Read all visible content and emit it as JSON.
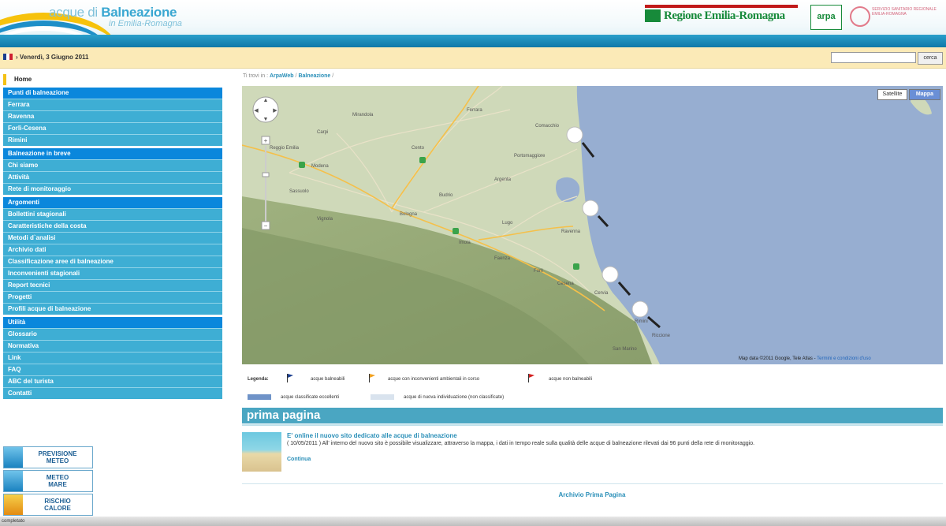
{
  "header": {
    "logo_prefix": "acque di ",
    "logo_main": "Balneazione",
    "logo_sub": "in Emilia-Romagna",
    "regione": "Regione Emilia-Romagna",
    "arpa": "arpa",
    "ssr": "SERVIZIO SANITARIO REGIONALE EMILIA-ROMAGNA"
  },
  "datebar": {
    "date": "› Venerdì, 3 Giugno 2011",
    "search_value": "",
    "search_button": "cerca"
  },
  "nav": {
    "home": "Home",
    "sections": [
      {
        "title": "Punti di balneazione",
        "items": [
          "Ferrara",
          "Ravenna",
          "Forlì-Cesena",
          "Rimini"
        ]
      },
      {
        "title": "Balneazione in breve",
        "items": [
          "Chi siamo",
          "Attività",
          "Rete di monitoraggio"
        ]
      },
      {
        "title": "Argomenti",
        "items": [
          "Bollettini stagionali",
          "Caratteristiche della costa",
          "Metodi d`analisi",
          "Archivio dati",
          "Classificazione aree di balneazione",
          "Inconvenienti stagionali",
          "Report tecnici",
          "Progetti",
          "Profili acque di balneazione"
        ]
      },
      {
        "title": "Utilità",
        "items": [
          "Glossario",
          "Normativa",
          "Link",
          "FAQ",
          "ABC del turista",
          "Contatti"
        ]
      }
    ]
  },
  "badges": [
    {
      "line1": "PREVISIONE",
      "line2": "METEO"
    },
    {
      "line1": "METEO",
      "line2": "MARE"
    },
    {
      "line1": "RISCHIO",
      "line2": "CALORE"
    }
  ],
  "breadcrumb": {
    "prefix": "Ti trovi in :",
    "items": [
      "ArpaWeb",
      "Balneazione"
    ]
  },
  "map": {
    "type_satellite": "Satellite",
    "type_map": "Mappa",
    "attribution": "Map data ©2011 Google, Tele Atlas - ",
    "terms": "Termini e condizioni d'uso",
    "places": [
      "Ferrara",
      "Modena",
      "Bologna",
      "Comacchio",
      "Ravenna",
      "Cervia",
      "Rimini",
      "Forlì",
      "Cesena",
      "Faenza",
      "Imola",
      "Reggio Emilia",
      "Carpi",
      "Mirandola",
      "Lugo",
      "Argenta",
      "Portomaggiore",
      "Cento",
      "Budrio",
      "Sassuolo",
      "Vignola",
      "Riccione",
      "San Marino"
    ]
  },
  "legend": {
    "label": "Legenda:",
    "item1": "acque balneabili",
    "item2": "acque con inconvenienti ambientali in corso",
    "item3": "acque non balneabili",
    "item4": "acque classificate eccellenti",
    "item5": "acque di nuova individuazione (non classificate)",
    "colors": {
      "blue": "#1c3f8f",
      "orange": "#f0a020",
      "red": "#d42020",
      "excellent": "#6f93c8",
      "new": "#d9e3ee"
    }
  },
  "prima_pagina": {
    "title": "prima pagina"
  },
  "news": {
    "title": "E' online il nuovo sito dedicato alle acque di balneazione",
    "text": "( 10/05/2011 ) All' interno del nuovo sito è possibile visualizzare, attraverso la mappa, i dati in tempo reale sulla qualità delle acque di balneazione rilevati dai 96 punti della rete di monitoraggio.",
    "more": "Continua"
  },
  "archivio": "Archivio Prima Pagina",
  "statusbar": "completato"
}
